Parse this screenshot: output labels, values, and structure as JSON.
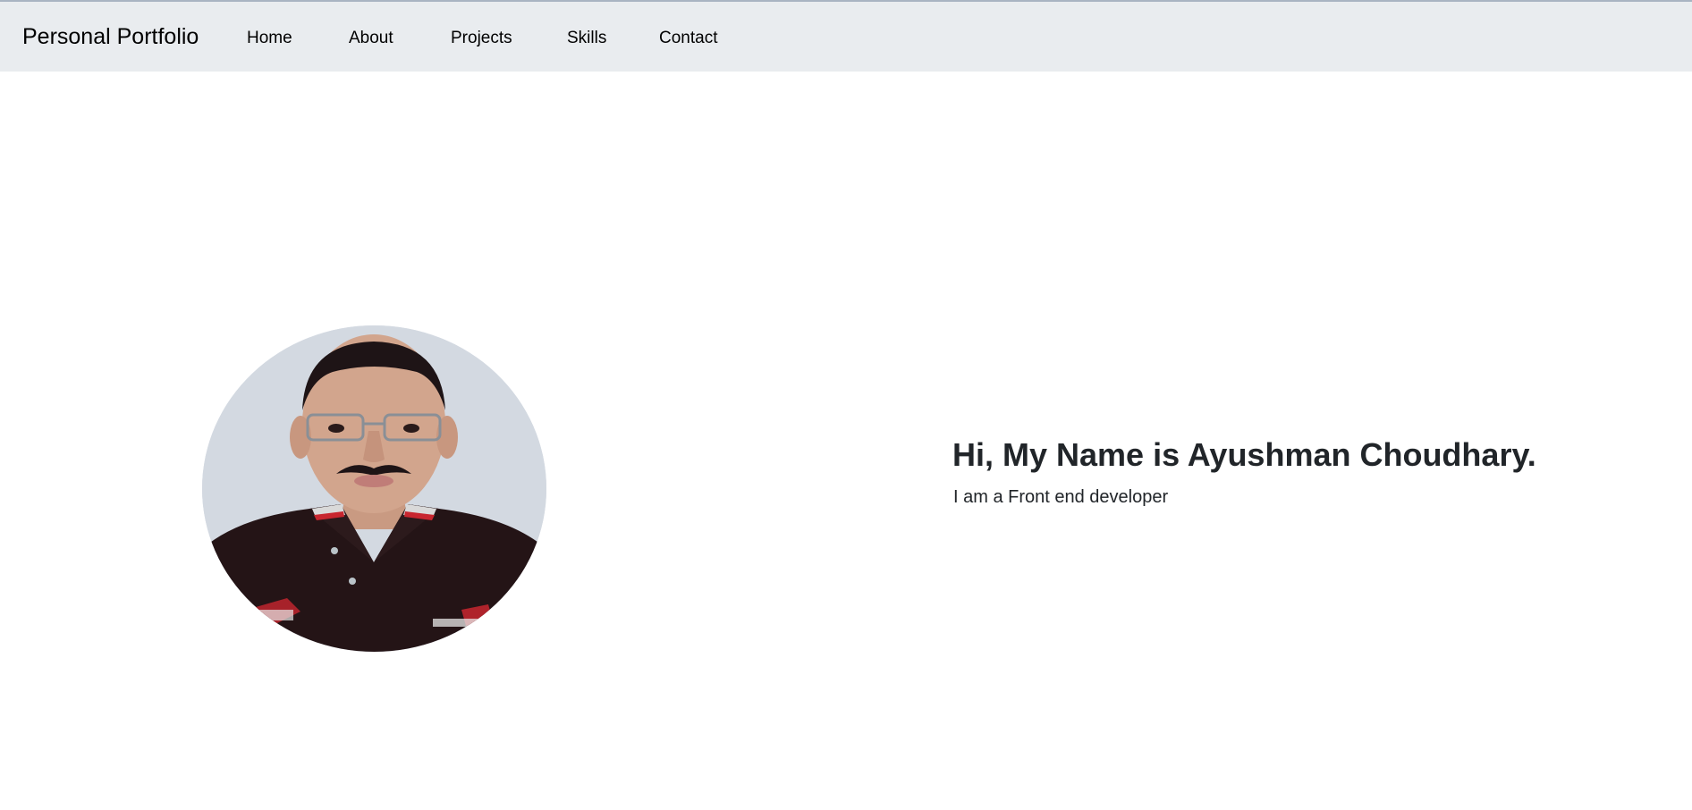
{
  "navbar": {
    "brand": "Personal Portfolio",
    "links": [
      "Home",
      "About",
      "Projects",
      "Skills",
      "Contact"
    ]
  },
  "hero": {
    "title": "Hi, My Name is Ayushman Choudhary.",
    "subtitle": "I am a Front end developer"
  },
  "colors": {
    "navbar_bg": "#e9ecef",
    "text": "#212529",
    "page_bg": "#ffffff"
  }
}
